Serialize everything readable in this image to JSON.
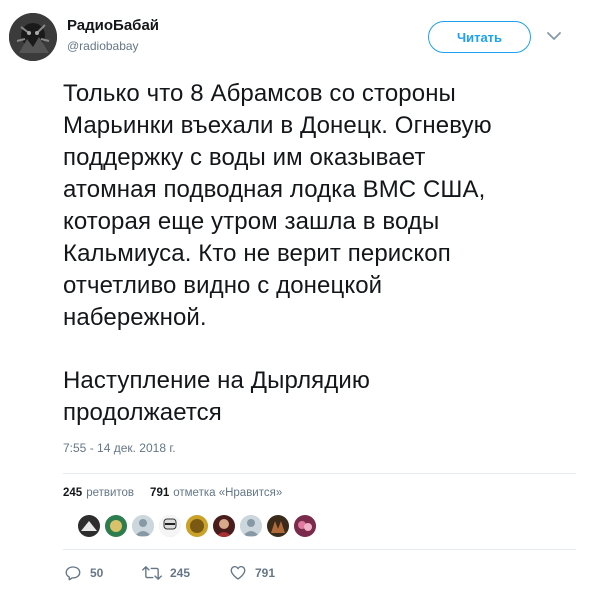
{
  "user": {
    "name": "РадиоБабай",
    "handle": "@radiobabay"
  },
  "follow_button": {
    "label": "Читать"
  },
  "tweet": {
    "lines": [
      "Только что 8 Абрамсов со стороны",
      "Марьинки въехали в Донецк. Огневую",
      "поддержку с воды им оказывает",
      "атомная подводная лодка ВМС США,",
      "которая еще утром зашла в воды",
      "Кальмиуса. Кто не верит перископ",
      "отчетливо видно с донецкой",
      "набережной."
    ],
    "lines2": [
      "Наступление на Дырлядию",
      "продолжается"
    ],
    "timestamp": "7:55 - 14 дек. 2018 г."
  },
  "stats": {
    "retweets_count": "245",
    "retweets_label": "ретвитов",
    "likes_count": "791",
    "likes_label": "отметка «Нравится»"
  },
  "actions": {
    "replies": "50",
    "retweets": "245",
    "likes": "791"
  },
  "colors": {
    "accent": "#1da1f2",
    "muted": "#657786",
    "text": "#14171a",
    "divider": "#e6ecf0"
  }
}
